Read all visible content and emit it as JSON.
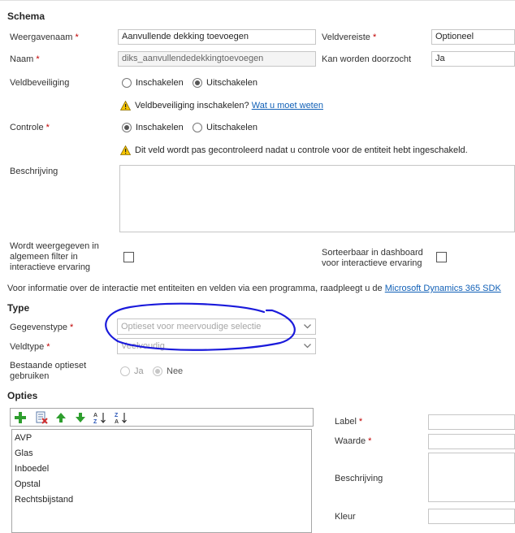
{
  "schema": {
    "title": "Schema",
    "weergavenaam": {
      "label": "Weergavenaam",
      "value": "Aanvullende dekking toevoegen"
    },
    "naam": {
      "label": "Naam",
      "value": "diks_aanvullendedekkingtoevoegen"
    },
    "veldvereiste": {
      "label": "Veldvereiste",
      "value": "Optioneel"
    },
    "kan_worden_doorzocht": {
      "label": "Kan worden doorzocht",
      "value": "Ja"
    },
    "veldbeveiliging": {
      "label": "Veldbeveiliging",
      "option_on": "Inschakelen",
      "option_off": "Uitschakelen",
      "selected": "Uitschakelen",
      "warning": "Veldbeveiliging inschakelen?",
      "link": "Wat u moet weten"
    },
    "controle": {
      "label": "Controle",
      "option_on": "Inschakelen",
      "option_off": "Uitschakelen",
      "selected": "Inschakelen",
      "warning": "Dit veld wordt pas gecontroleerd nadat u controle voor de entiteit hebt ingeschakeld."
    },
    "beschrijving": {
      "label": "Beschrijving",
      "value": ""
    },
    "weergegeven_filter": {
      "label_line1": "Wordt weergegeven in",
      "label_line2": "algemeen filter in",
      "label_line3": "interactieve ervaring",
      "checked": false
    },
    "sorteerbaar": {
      "label_line1": "Sorteerbaar in dashboard",
      "label_line2": "voor interactieve ervaring",
      "checked": false
    },
    "info_text": "Voor informatie over de interactie met entiteiten en velden via een programma, raadpleegt u de",
    "info_link": "Microsoft Dynamics 365 SDK"
  },
  "type": {
    "title": "Type",
    "gegevenstype": {
      "label": "Gegevenstype",
      "value": "Optieset voor meervoudige selectie"
    },
    "veldtype": {
      "label": "Veldtype",
      "value": "Veelvoudig"
    },
    "bestaande_optieset": {
      "label_line1": "Bestaande optieset",
      "label_line2": "gebruiken",
      "option_yes": "Ja",
      "option_no": "Nee",
      "selected": "Nee"
    }
  },
  "opties": {
    "title": "Opties",
    "toolbar": {
      "add": "add-icon",
      "edit": "edit-icon",
      "up": "arrow-up-icon",
      "down": "arrow-down-icon",
      "sort_az": "sort-az-icon",
      "sort_za": "sort-za-icon"
    },
    "items": [
      "AVP",
      "Glas",
      "Inboedel",
      "Opstal",
      "Rechtsbijstand"
    ],
    "detail": {
      "label": "Label",
      "waarde": "Waarde",
      "beschrijving": "Beschrijving",
      "kleur": "Kleur"
    }
  },
  "colors": {
    "required": "#c00000",
    "link": "#1160b7",
    "annotation": "#1a1adb",
    "warning": "#f5c400"
  }
}
